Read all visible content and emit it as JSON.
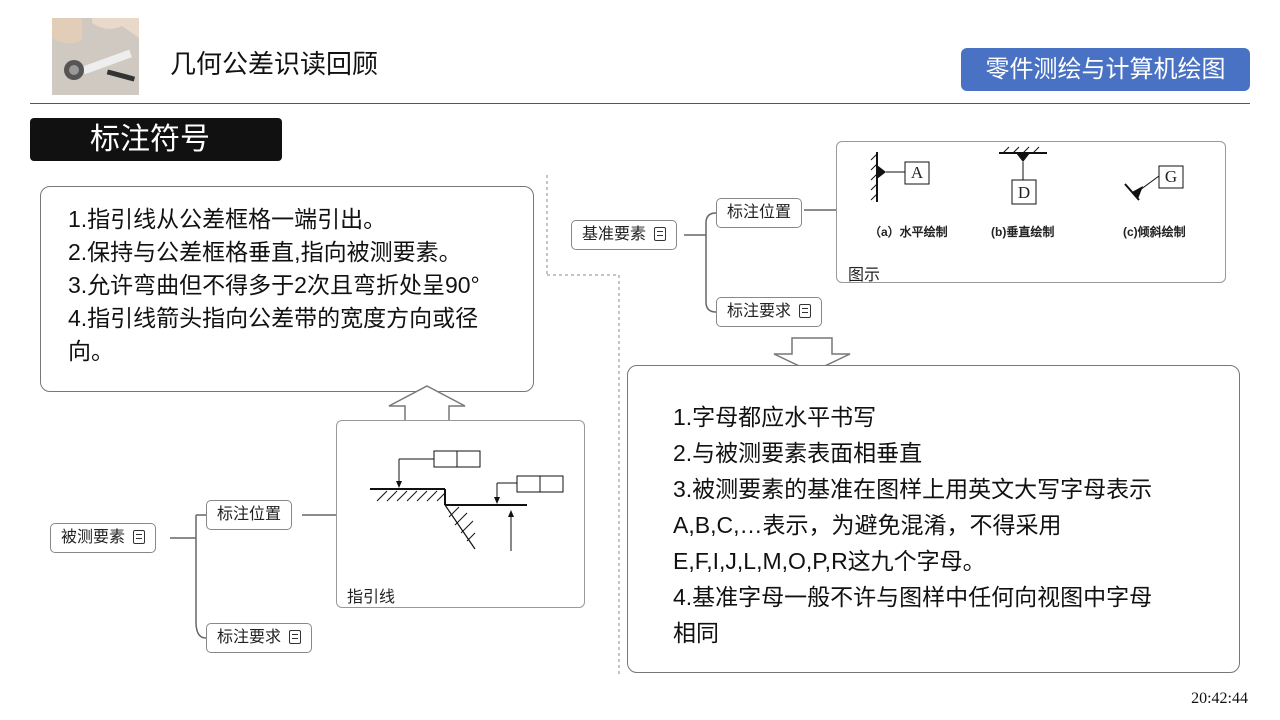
{
  "header": {
    "title": "几何公差识读回顾",
    "course": "零件测绘与计算机绘图"
  },
  "section_tag": "标注符号",
  "leader_card": {
    "lines": [
      "1.指引线从公差框格一端引出。",
      "2.保持与公差框格垂直,指向被测要素。",
      "3.允许弯曲但不得多于2次且弯折处呈90°",
      "4.指引线箭头指向公差带的宽度方向或径向。"
    ]
  },
  "measured_map": {
    "root": "被测要素",
    "position": "标注位置",
    "requirement": "标注要求",
    "panel_caption": "指引线"
  },
  "datum_map": {
    "root": "基准要素",
    "position": "标注位置",
    "requirement": "标注要求",
    "panel_caption": "图示",
    "figures": [
      {
        "letter": "A",
        "caption": "（a）水平绘制"
      },
      {
        "letter": "D",
        "caption": "(b)垂直绘制"
      },
      {
        "letter": "G",
        "caption": "(c)倾斜绘制"
      }
    ]
  },
  "datum_card": {
    "lines": [
      "1.字母都应水平书写",
      "2.与被测要素表面相垂直",
      "3.被测要素的基准在图样上用英文大写字母表示",
      "A,B,C,…表示，为避免混淆，不得采用",
      "E,F,I,J,L,M,O,P,R这九个字母。",
      "4.基准字母一般不许与图样中任何向视图中字母",
      "相同"
    ]
  },
  "clock": "20:42:44",
  "colors": {
    "badge": "#4a72c4",
    "tag": "#111111"
  }
}
